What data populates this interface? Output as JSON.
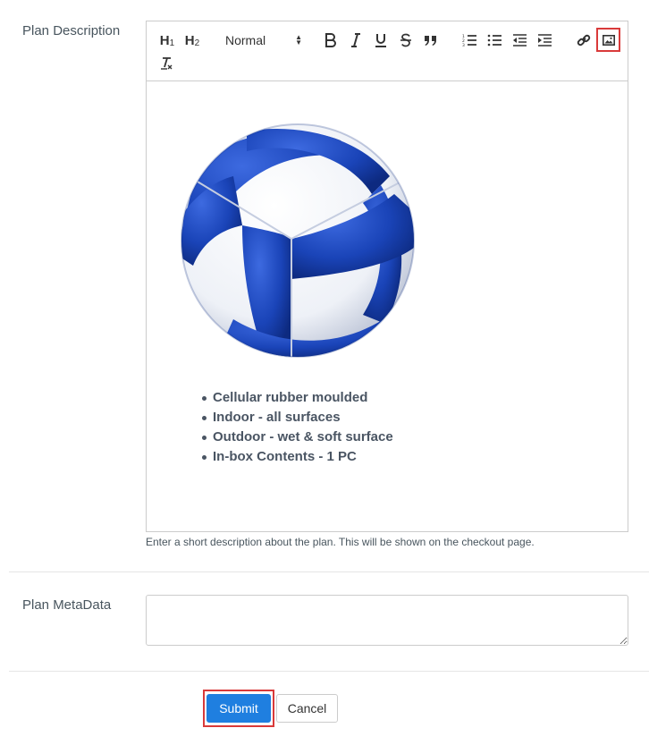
{
  "form": {
    "description_label": "Plan Description",
    "metadata_label": "Plan MetaData",
    "description_help": "Enter a short description about the plan. This will be shown on the checkout page.",
    "metadata_value": ""
  },
  "toolbar": {
    "h1": "H",
    "h1_sub": "1",
    "h2": "H",
    "h2_sub": "2",
    "format_select": "Normal",
    "icons": [
      "bold-icon",
      "italic-icon",
      "underline-icon",
      "strikethrough-icon",
      "blockquote-icon",
      "ordered-list-icon",
      "bullet-list-icon",
      "outdent-icon",
      "indent-icon",
      "link-icon",
      "image-icon",
      "clear-format-icon"
    ],
    "highlighted": "image-icon"
  },
  "editor": {
    "image": "volleyball",
    "bullets": [
      "Cellular rubber moulded",
      "Indoor - all surfaces",
      "Outdoor - wet & soft surface",
      "In-box Contents - 1 PC"
    ]
  },
  "buttons": {
    "submit": "Submit",
    "cancel": "Cancel"
  },
  "colors": {
    "primary": "#1f7fe0",
    "highlight_border": "#d93a3a",
    "ball_blue": "#1a44b8"
  }
}
